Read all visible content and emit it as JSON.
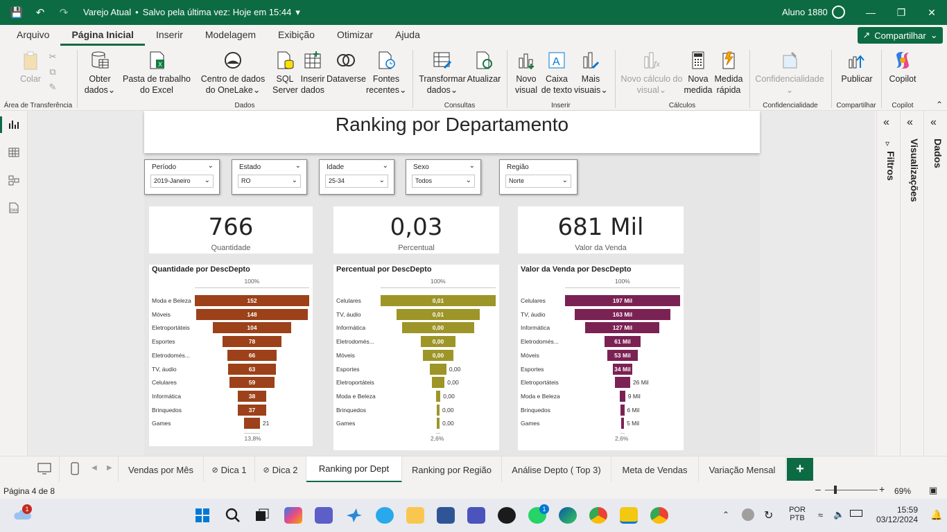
{
  "titlebar": {
    "doc_name": "Varejo Atual",
    "saved_text": "Salvo pela última vez: Hoje em 15:44",
    "user": "Aluno 1880"
  },
  "menu": {
    "tabs": [
      "Arquivo",
      "Página Inicial",
      "Inserir",
      "Modelagem",
      "Exibição",
      "Otimizar",
      "Ajuda"
    ],
    "share": "Compartilhar"
  },
  "ribbon": {
    "colar": "Colar",
    "obter_dados": "Obter dados",
    "pasta_excel": "Pasta de trabalho do Excel",
    "onelake": "Centro de dados do OneLake",
    "sql": "SQL Server",
    "inserir_dados": "Inserir dados",
    "dataverse": "Dataverse",
    "fontes": "Fontes recentes",
    "transformar": "Transformar dados",
    "atualizar": "Atualizar",
    "novo_visual": "Novo visual",
    "caixa_texto": "Caixa de texto",
    "mais_visuais": "Mais visuais",
    "novo_calculo": "Novo cálculo do visual",
    "nova_medida": "Nova medida",
    "medida_rapida": "Medida rápida",
    "confidencialidade": "Confidencialidade",
    "publicar": "Publicar",
    "copilot": "Copilot",
    "groups": {
      "transferencia": "Área de Transferência",
      "dados": "Dados",
      "consultas": "Consultas",
      "inserir": "Inserir",
      "calculos": "Cálculos",
      "confidencialidade": "Confidencialidade",
      "compartilhar": "Compartilhar",
      "copilot": "Copilot"
    }
  },
  "report": {
    "title": "Ranking por Departamento",
    "slicers": [
      {
        "label": "Período",
        "value": "2019-Janeiro"
      },
      {
        "label": "Estado",
        "value": "RO"
      },
      {
        "label": "Idade",
        "value": "25-34"
      },
      {
        "label": "Sexo",
        "value": "Todos"
      },
      {
        "label": "Região",
        "value": "Norte"
      }
    ],
    "cards": [
      {
        "value": "766",
        "caption": "Quantidade"
      },
      {
        "value": "0,03",
        "caption": "Percentual"
      },
      {
        "value": "681 Mil",
        "caption": "Valor da Venda"
      }
    ]
  },
  "chart_data": [
    {
      "type": "funnel",
      "title": "Quantidade por DescDepto",
      "top_pct": "100%",
      "bottom_pct": "13,8%",
      "color": "#9c4119",
      "categories": [
        "Moda e Beleza",
        "Móveis",
        "Eletroportáteis",
        "Esportes",
        "Eletrodomés...",
        "TV, áudio",
        "Celulares",
        "Informática",
        "Brinquedos",
        "Games"
      ],
      "values": [
        152,
        148,
        104,
        78,
        66,
        63,
        59,
        38,
        37,
        21
      ],
      "labels": [
        "152",
        "148",
        "104",
        "78",
        "66",
        "63",
        "59",
        "38",
        "37",
        "21"
      ]
    },
    {
      "type": "funnel",
      "title": "Percentual por DescDepto",
      "top_pct": "100%",
      "bottom_pct": "2,6%",
      "color": "#9d9528",
      "categories": [
        "Celulares",
        "TV, áudio",
        "Informática",
        "Eletrodomés...",
        "Móveis",
        "Esportes",
        "Eletroportáteis",
        "Moda e Beleza",
        "Brinquedos",
        "Games"
      ],
      "values": [
        0.0126,
        0.0091,
        0.0079,
        0.0038,
        0.0033,
        0.0018,
        0.0014,
        0.0005,
        0.0003,
        0.00033
      ],
      "labels": [
        "0,01",
        "0,01",
        "0,00",
        "0,00",
        "0,00",
        "0,00",
        "0,00",
        "0,00",
        "0,00",
        "0,00"
      ]
    },
    {
      "type": "funnel",
      "title": "Valor da Venda por DescDepto",
      "top_pct": "100%",
      "bottom_pct": "2,6%",
      "color": "#7b2254",
      "categories": [
        "Celulares",
        "TV, áudio",
        "Informática",
        "Eletrodomés...",
        "Móveis",
        "Esportes",
        "Eletroportáteis",
        "Moda e Beleza",
        "Brinquedos",
        "Games"
      ],
      "values": [
        197,
        163,
        127,
        61,
        53,
        34,
        26,
        9,
        6,
        5
      ],
      "labels": [
        "197 Mil",
        "163 Mil",
        "127 Mil",
        "61 Mil",
        "53 Mil",
        "34 Mil",
        "26 Mil",
        "9 Mil",
        "6 Mil",
        "5 Mil"
      ]
    }
  ],
  "panes": {
    "filtros": "Filtros",
    "visualizacoes": "Visualizações",
    "dados": "Dados"
  },
  "pages": [
    "Vendas por Mês",
    "Dica 1",
    "Dica 2",
    "Ranking por Dept",
    "Ranking por Região",
    "Análise Depto ( Top 3)",
    "Meta de Vendas",
    "Variação Mensal"
  ],
  "status": {
    "page": "Página 4 de 8",
    "zoom": "69%"
  },
  "taskbar": {
    "lang1": "POR",
    "lang2": "PTB",
    "time": "15:59",
    "date": "03/12/2024",
    "badge1": "1",
    "badge2": "1"
  },
  "colors": {
    "brand": "#0d6b43"
  }
}
